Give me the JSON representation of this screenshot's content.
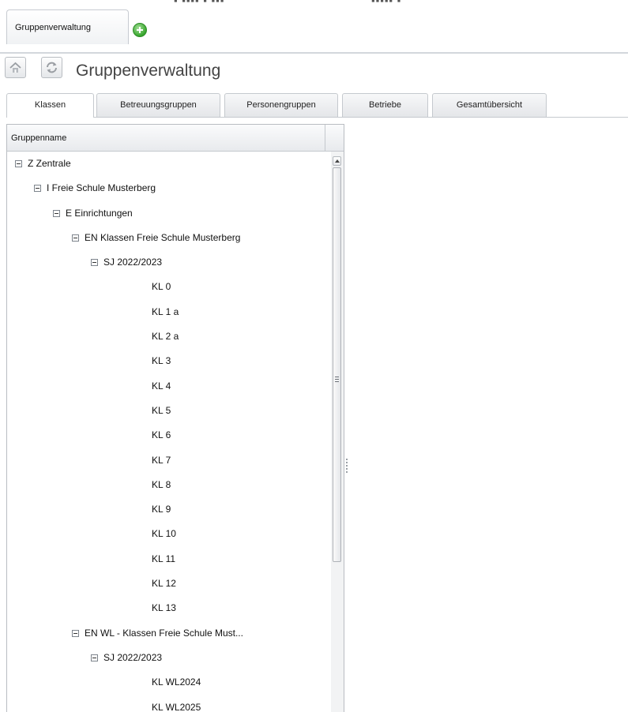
{
  "main_tab": {
    "label": "Gruppenverwaltung"
  },
  "header": {
    "title": "Gruppenverwaltung"
  },
  "tabs": [
    "Klassen",
    "Betreuungsgruppen",
    "Personengruppen",
    "Betriebe",
    "Gesamtübersicht"
  ],
  "active_tab": "Klassen",
  "grid": {
    "column_header": "Gruppenname",
    "rows": [
      {
        "label": "Z Zentrale",
        "level": 0,
        "expanded": true
      },
      {
        "label": "I Freie Schule Musterberg",
        "level": 1,
        "expanded": true
      },
      {
        "label": "E Einrichtungen",
        "level": 2,
        "expanded": true
      },
      {
        "label": "EN Klassen Freie Schule Musterberg",
        "level": 3,
        "expanded": true
      },
      {
        "label": "SJ 2022/2023",
        "level": 4,
        "expanded": true
      },
      {
        "label": "KL 0",
        "level": 5,
        "expanded": false
      },
      {
        "label": "KL 1 a",
        "level": 5,
        "expanded": false
      },
      {
        "label": "KL 2 a",
        "level": 5,
        "expanded": false
      },
      {
        "label": "KL 3",
        "level": 5,
        "expanded": false
      },
      {
        "label": "KL 4",
        "level": 5,
        "expanded": false
      },
      {
        "label": "KL 5",
        "level": 5,
        "expanded": false
      },
      {
        "label": "KL 6",
        "level": 5,
        "expanded": false
      },
      {
        "label": "KL 7",
        "level": 5,
        "expanded": false
      },
      {
        "label": "KL 8",
        "level": 5,
        "expanded": false
      },
      {
        "label": "KL 9",
        "level": 5,
        "expanded": false
      },
      {
        "label": "KL 10",
        "level": 5,
        "expanded": false
      },
      {
        "label": "KL 11",
        "level": 5,
        "expanded": false
      },
      {
        "label": "KL 12",
        "level": 5,
        "expanded": false
      },
      {
        "label": "KL 13",
        "level": 5,
        "expanded": false
      },
      {
        "label": "EN WL - Klassen Freie Schule Must...",
        "level": 3,
        "expanded": true
      },
      {
        "label": "SJ 2022/2023",
        "level": 4,
        "expanded": true
      },
      {
        "label": "KL WL2024",
        "level": 5,
        "expanded": false
      },
      {
        "label": "KL WL2025",
        "level": 5,
        "expanded": false
      }
    ]
  },
  "icons": {
    "add": "add-tab-icon",
    "home": "home-icon",
    "refresh": "refresh-icon",
    "collapse": "minus-box-icon",
    "scroll_up": "scroll-up-arrow-icon"
  },
  "colors": {
    "add_green": "#36a52c",
    "border": "#c5c9ce",
    "title_text": "#444444"
  }
}
